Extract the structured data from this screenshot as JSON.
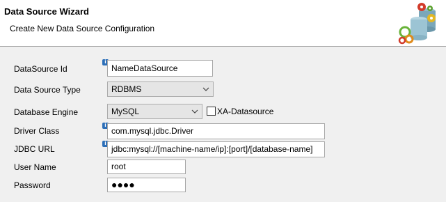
{
  "header": {
    "title": "Data Source Wizard",
    "subtitle": "Create New Data Source Configuration",
    "logo_icon": "database-gears-icon"
  },
  "form": {
    "datasource_id": {
      "label": "DataSource Id",
      "value": "NameDataSource"
    },
    "datasource_type": {
      "label": "Data Source Type",
      "value": "RDBMS"
    },
    "database_engine": {
      "label": "Database Engine",
      "value": "MySQL"
    },
    "xa_datasource": {
      "label": "XA-Datasource",
      "checked": false
    },
    "driver_class": {
      "label": "Driver Class",
      "value": "com.mysql.jdbc.Driver"
    },
    "jdbc_url": {
      "label": "JDBC URL",
      "value": "jdbc:mysql://[machine-name/ip]:[port]/[database-name]"
    },
    "user_name": {
      "label": "User Name",
      "value": "root"
    },
    "password": {
      "label": "Password",
      "value": "●●●●"
    }
  },
  "colors": {
    "info_icon": "#2c6fb8",
    "background": "#f0f0f0",
    "header_background": "#ffffff"
  }
}
